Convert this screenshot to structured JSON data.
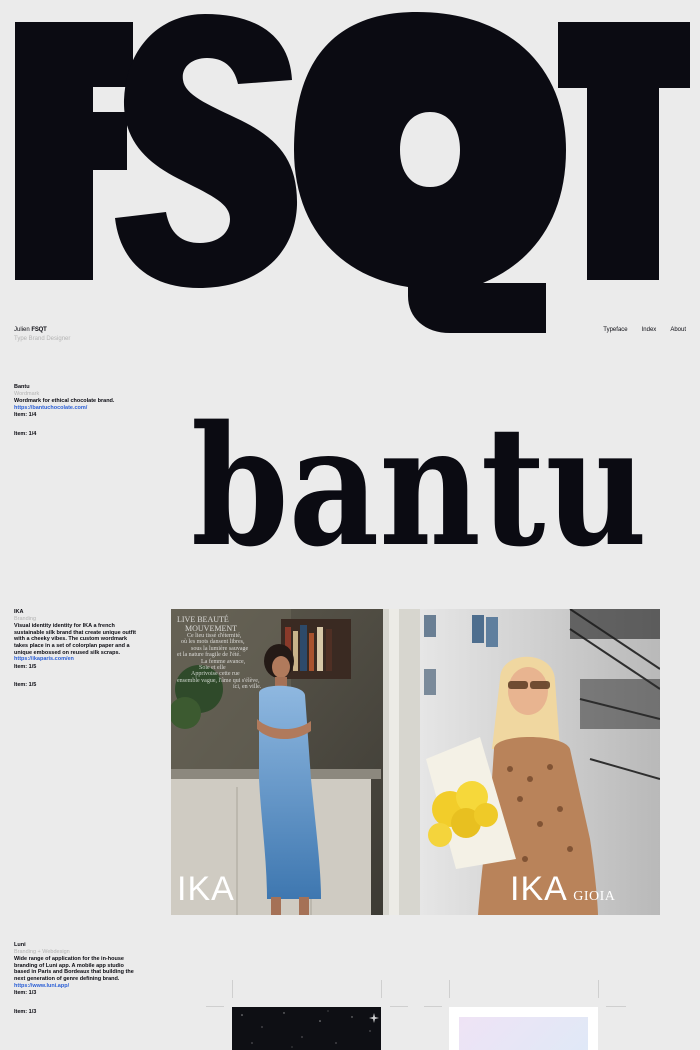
{
  "hero": {
    "logo_text": "FSQT"
  },
  "nav": {
    "name": "Julien",
    "brand": "FSQT",
    "subtitle": "Type Brand Designer",
    "links": [
      {
        "label": "Typeface"
      },
      {
        "label": "Index"
      },
      {
        "label": "About"
      }
    ]
  },
  "projects": [
    {
      "title": "Bantu",
      "category": "Wordmark",
      "description": "Wordmark for ethical chocolate brand.",
      "link": "https://bantuchocolate.com/",
      "item": "Item: 1/4",
      "item_repeat": "Item: 1/4",
      "wordmark": "bantu"
    },
    {
      "title": "IKA",
      "category": "Branding",
      "description": "Visual identity identity for IKA a french sustainable silk brand that create unique outfit with a cheeky vibes. The custom wordmark takes place in a set of colorplan paper and a unique embossed on reused silk scraps.",
      "link": "https://ikaparis.com/en",
      "item": "Item: 1/5",
      "item_repeat": "Item: 1/5",
      "photo_left_logo": "IKA",
      "photo_right_logo": "IKA",
      "photo_right_sub": "GIOIA",
      "poem": [
        "LIVE BEAUTÉ",
        "MOUVEMENT",
        "Ce lieu tissé d'éternité,",
        "où les mots dansent libres,",
        "sous la lumière sauvage",
        "et la nature fragile de l'été.",
        "La femme avance,",
        "Soie et elle",
        "Apprivoise cette rue",
        "ensemble vague, l'âme qui s'élève,",
        "ici, en ville."
      ]
    },
    {
      "title": "Luni",
      "category": "Branding + Webdesign",
      "description": "Wide range of application for the in-house branding of Luni app. A mobile app studio based in Paris and Bordeaux that building the next generation of genre defining brand.",
      "link": "https://www.luni.app/",
      "item": "Item: 1/3",
      "item_repeat": "Item: 1/3"
    }
  ],
  "colors": {
    "background": "#ebebeb",
    "ink": "#0b0b12",
    "link": "#2a5fd6",
    "muted": "#b4b4b4"
  }
}
